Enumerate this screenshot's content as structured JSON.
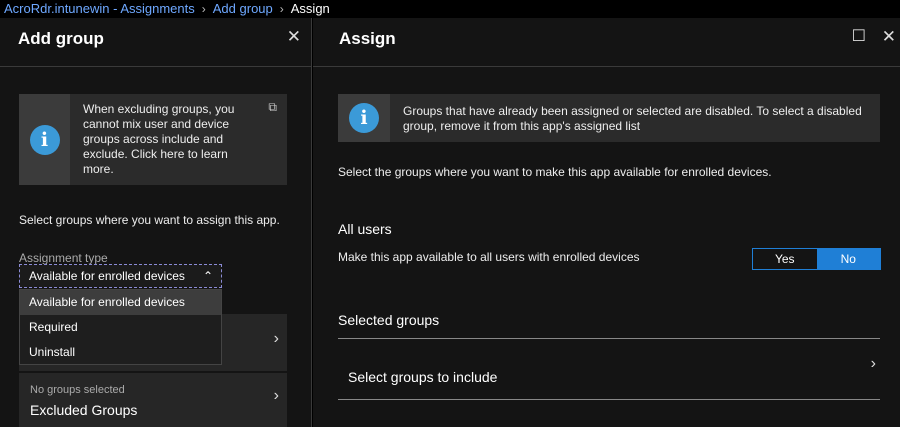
{
  "breadcrumb": {
    "items": [
      "AcroRdr.intunewin - Assignments",
      "Add group"
    ],
    "current": "Assign",
    "separator": "›"
  },
  "left_blade": {
    "title": "Add group",
    "close_icon": "✕",
    "info": {
      "text": "When excluding groups, you cannot mix user and device groups across include and exclude.  Click here to learn more.",
      "link_icon": "⧉"
    },
    "description": "Select groups where you want to assign this app.",
    "assignment_type_label": "Assignment type",
    "assignment_type_value": "Available for enrolled devices",
    "dropdown_options": [
      "Available for enrolled devices",
      "Required",
      "Uninstall"
    ],
    "excluded": {
      "status": "No groups selected",
      "label": "Excluded Groups"
    }
  },
  "right_blade": {
    "title": "Assign",
    "maximize_icon": "☐",
    "close_icon": "✕",
    "info": {
      "text": "Groups that have already been assigned or selected are disabled. To select a disabled group, remove it from this app's assigned list"
    },
    "description": "Select the groups where you want to make this app available for enrolled devices.",
    "all_users": {
      "heading": "All users",
      "text": "Make this app available to all users with enrolled devices",
      "yes": "Yes",
      "no": "No",
      "selected": "No"
    },
    "selected_groups": {
      "heading": "Selected groups",
      "select_label": "Select groups to include"
    }
  },
  "colors": {
    "accent": "#1f7fd6",
    "link": "#6ea8ff",
    "info_icon": "#3b9ad8",
    "background": "#141414"
  }
}
